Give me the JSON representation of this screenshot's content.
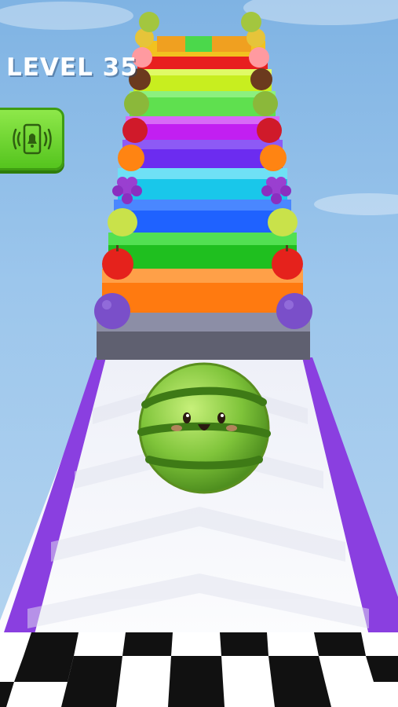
{
  "hud": {
    "level_label": "LEVEL 35",
    "vibration_icon": "phone-vibrate-bell-icon"
  },
  "stairs": {
    "step_colors": [
      "#8c8ea6",
      "#ff7a10",
      "#1fbf1f",
      "#1f62ff",
      "#19c7ea",
      "#6c2cf0",
      "#c21ff1",
      "#5fe04f",
      "#c8ee1f",
      "#e81f1f",
      "#f2c21f"
    ]
  },
  "fruits": [
    "plum",
    "apple",
    "lemon",
    "grape",
    "orange",
    "pomegranate",
    "kiwi",
    "coconut",
    "peach",
    "pear",
    "melon"
  ],
  "player": {
    "fruit": "watermelon"
  },
  "track": {
    "rail_color": "#8a3fe0",
    "finish_pattern": "checkered"
  }
}
